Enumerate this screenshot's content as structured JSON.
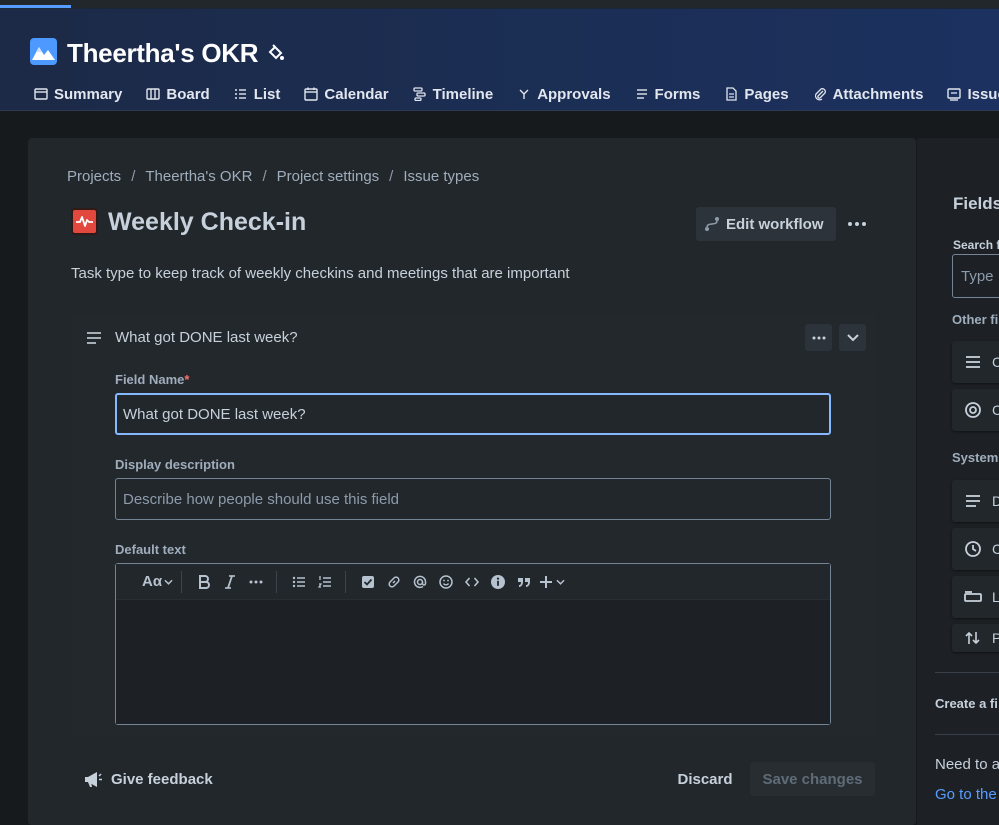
{
  "project": {
    "title": "Theertha's OKR"
  },
  "nav_tabs": [
    {
      "label": "Summary",
      "icon": "summary-icon"
    },
    {
      "label": "Board",
      "icon": "board-icon"
    },
    {
      "label": "List",
      "icon": "list-icon"
    },
    {
      "label": "Calendar",
      "icon": "calendar-icon"
    },
    {
      "label": "Timeline",
      "icon": "timeline-icon"
    },
    {
      "label": "Approvals",
      "icon": "approvals-icon"
    },
    {
      "label": "Forms",
      "icon": "forms-icon"
    },
    {
      "label": "Pages",
      "icon": "pages-icon"
    },
    {
      "label": "Attachments",
      "icon": "attachments-icon"
    },
    {
      "label": "Issues",
      "icon": "issues-icon"
    }
  ],
  "breadcrumb": [
    "Projects",
    "Theertha's OKR",
    "Project settings",
    "Issue types"
  ],
  "breadcrumb_separator": "/",
  "issue_type": {
    "title": "Weekly Check-in",
    "description": "Task type to keep track of weekly checkins and meetings that are important",
    "icon_color": "#e2483d"
  },
  "actions": {
    "edit_workflow": "Edit workflow"
  },
  "field_card": {
    "title": "What got DONE last week?",
    "field_name_label": "Field Name",
    "required_marker": "*",
    "field_name_value": "What got DONE last week?",
    "display_description_label": "Display description",
    "display_description_placeholder": "Describe how people should use this field",
    "default_text_label": "Default text",
    "toolbar_text_style": "Aα"
  },
  "footer": {
    "feedback": "Give feedback",
    "discard": "Discard",
    "save": "Save changes"
  },
  "right_panel": {
    "title": "Fields",
    "search_label": "Search f",
    "search_placeholder": "Type",
    "other_fields_label": "Other fi",
    "system_label": "System",
    "other_items": [
      {
        "text": "C",
        "icon": "paragraph-icon"
      },
      {
        "text": "C",
        "icon": "radio-icon"
      }
    ],
    "system_items": [
      {
        "text": "D",
        "icon": "paragraph-icon"
      },
      {
        "text": "C",
        "icon": "clock-icon"
      },
      {
        "text": "L",
        "icon": "label-icon"
      },
      {
        "text": "P",
        "icon": "priority-icon"
      }
    ],
    "create_label": "Create a fi",
    "need_text": "Need to a",
    "goto_link": "Go to the"
  },
  "colors": {
    "accent": "#579dff",
    "header_bg": "#1b2e55",
    "focus_border": "#85b8ff"
  }
}
